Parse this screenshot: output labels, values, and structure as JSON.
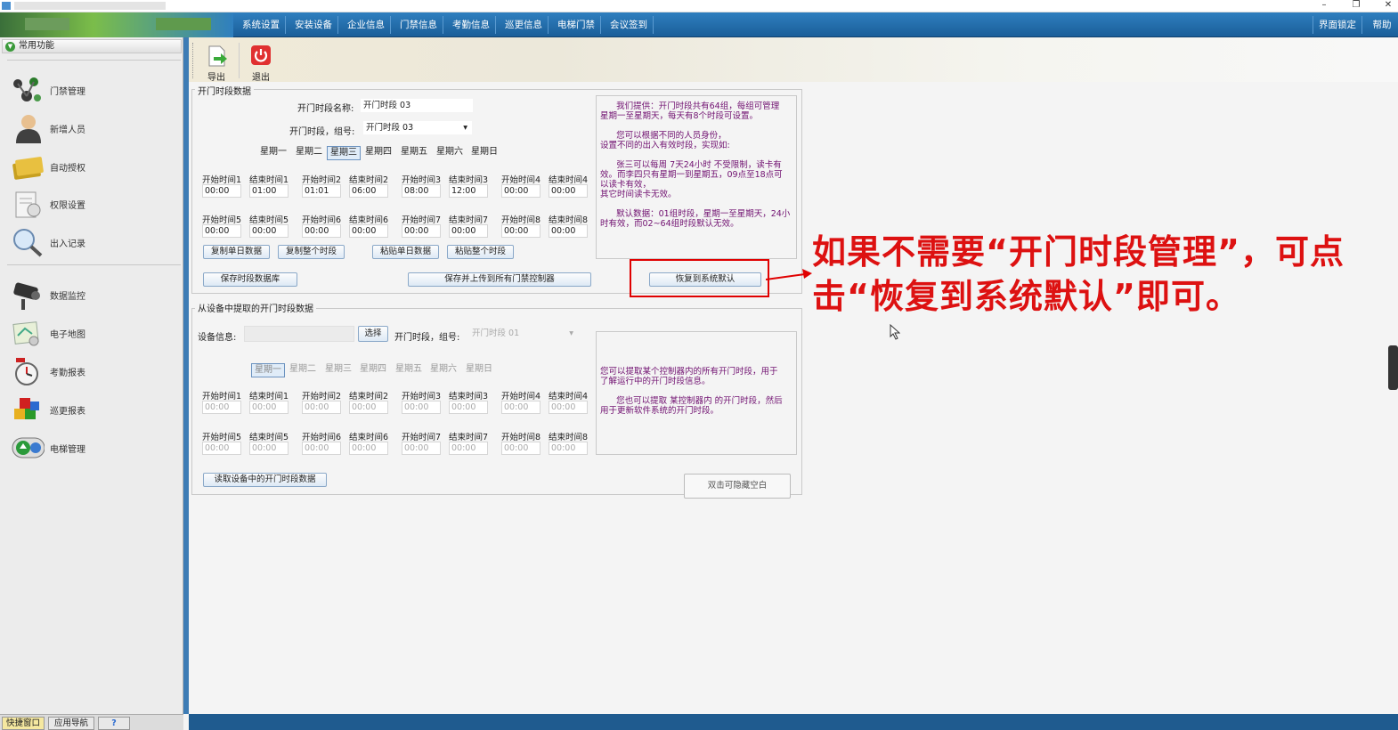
{
  "menubar": {
    "items": [
      "系统设置",
      "安装设备",
      "企业信息",
      "门禁信息",
      "考勤信息",
      "巡更信息",
      "电梯门禁",
      "会议签到"
    ],
    "right": [
      "界面锁定",
      "帮助"
    ]
  },
  "window": {
    "minimize": "–",
    "restore": "❐",
    "close": "✕"
  },
  "sidebar": {
    "header": "常用功能",
    "group1": [
      "门禁管理",
      "新增人员",
      "自动授权",
      "权限设置",
      "出入记录"
    ],
    "group2": [
      "数据监控",
      "电子地图",
      "考勤报表",
      "巡更报表",
      "电梯管理"
    ],
    "bottom_tabs": [
      "快捷窗口",
      "应用导航",
      "?"
    ]
  },
  "toolbar": {
    "export": "导出",
    "exit": "退出"
  },
  "section1": {
    "title": "开门时段数据",
    "name_label": "开门时段名称:",
    "name_value": "开门时段 03",
    "group_label": "开门时段，组号:",
    "group_value": "开门时段 03",
    "days": [
      "星期一",
      "星期二",
      "星期三",
      "星期四",
      "星期五",
      "星期六",
      "星期日"
    ],
    "row1_labels": [
      "开始时间1",
      "结束时间1",
      "开始时间2",
      "结束时间2",
      "开始时间3",
      "结束时间3",
      "开始时间4",
      "结束时间4"
    ],
    "row1_values": [
      "00:00",
      "01:00",
      "01:01",
      "06:00",
      "08:00",
      "12:00",
      "00:00",
      "00:00"
    ],
    "row2_labels": [
      "开始时间5",
      "结束时间5",
      "开始时间6",
      "结束时间6",
      "开始时间7",
      "结束时间7",
      "开始时间8",
      "结束时间8"
    ],
    "row2_values": [
      "00:00",
      "00:00",
      "00:00",
      "00:00",
      "00:00",
      "00:00",
      "00:00",
      "00:00"
    ],
    "buttons": {
      "copy_day": "复制单日数据",
      "copy_all": "复制整个时段",
      "paste_day": "粘贴单日数据",
      "paste_all": "粘贴整个时段",
      "save_db": "保存时段数据库",
      "save_upload": "保存并上传到所有门禁控制器",
      "restore_default": "恢复到系统默认"
    },
    "info": "      我们提供：开门时段共有64组，每组可管理\n星期一至星期天，每天有8个时段可设置。\n\n      您可以根据不同的人员身份，\n设置不同的出入有效时段，实现如:\n\n      张三可以每周 7天24小时 不受限制，读卡有\n效。而李四只有星期一到星期五，09点至18点可\n以读卡有效，\n其它时间读卡无效。\n\n      默认数据：01组时段，星期一至星期天，24小\n时有效，而02~64组时段默认无效。"
  },
  "section2": {
    "title": "从设备中提取的开门时段数据",
    "device_label": "设备信息:",
    "select_btn": "选择",
    "group_label": "开门时段，组号:",
    "group_value": "开门时段 01",
    "days": [
      "星期一",
      "星期二",
      "星期三",
      "星期四",
      "星期五",
      "星期六",
      "星期日"
    ],
    "row1_labels": [
      "开始时间1",
      "结束时间1",
      "开始时间2",
      "结束时间2",
      "开始时间3",
      "结束时间3",
      "开始时间4",
      "结束时间4"
    ],
    "row1_values": [
      "00:00",
      "00:00",
      "00:00",
      "00:00",
      "00:00",
      "00:00",
      "00:00",
      "00:00"
    ],
    "row2_labels": [
      "开始时间5",
      "结束时间5",
      "开始时间6",
      "结束时间6",
      "开始时间7",
      "结束时间7",
      "开始时间8",
      "结束时间8"
    ],
    "row2_values": [
      "00:00",
      "00:00",
      "00:00",
      "00:00",
      "00:00",
      "00:00",
      "00:00",
      "00:00"
    ],
    "read_btn": "读取设备中的开门时段数据",
    "hide_btn": "双击可隐藏空白",
    "info": "\n\n\n您可以提取某个控制器内的所有开门时段，用于\n了解运行中的开门时段信息。\n\n      您也可以提取 某控制器内 的开门时段，然后\n用于更新软件系统的开门时段。"
  },
  "annotation": "如果不需要“开门时段管理”，可点击“恢复到系统默认”即可。",
  "colors": {
    "accent": "#1f5b8f",
    "annotation": "#dd1111",
    "info_text": "#701070"
  }
}
